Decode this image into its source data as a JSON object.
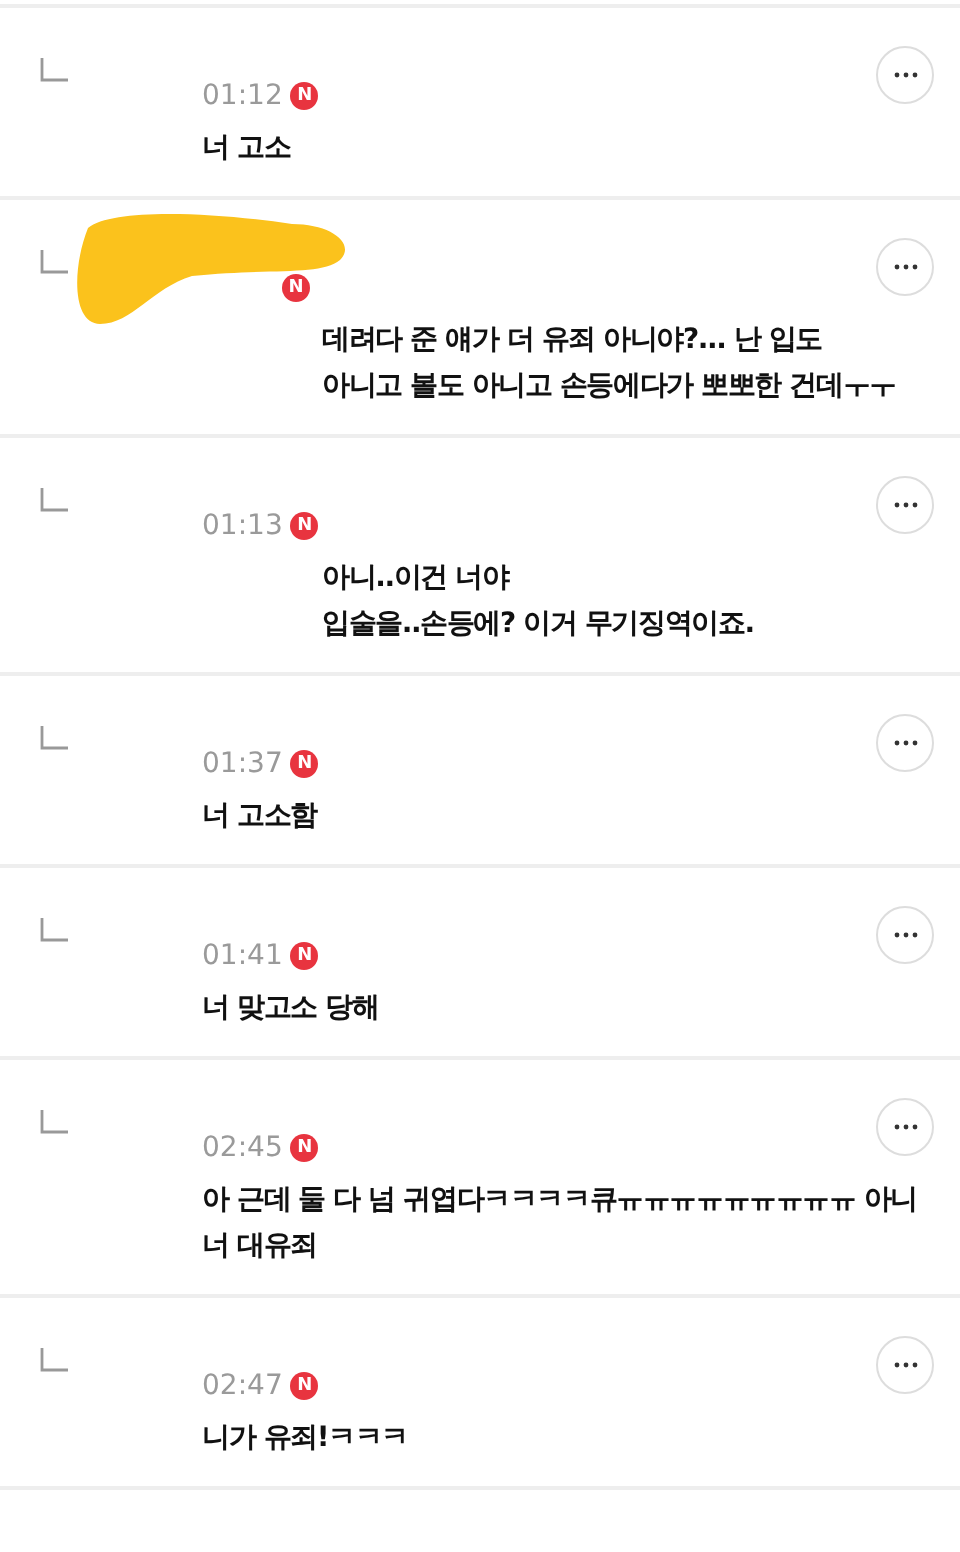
{
  "comments": [
    {
      "time": "01:12",
      "badge": "N",
      "redacted": false,
      "first_line_indented": false,
      "lines": [
        "너 고소"
      ]
    },
    {
      "badge": "N",
      "redacted": true,
      "first_line_indented": true,
      "lines": [
        "데려다 준 얘가 더 유죄 아니야?... 난 입도",
        "아니고 볼도 아니고 손등에다가 뽀뽀한 건데ㅜㅜ"
      ]
    },
    {
      "time": "01:13",
      "badge": "N",
      "redacted": false,
      "first_line_indented": true,
      "lines": [
        "아니..이건 너야",
        "입술을..손등에? 이거 무기징역이죠."
      ]
    },
    {
      "time": "01:37",
      "badge": "N",
      "redacted": false,
      "first_line_indented": false,
      "lines": [
        "너 고소함"
      ]
    },
    {
      "time": "01:41",
      "badge": "N",
      "redacted": false,
      "first_line_indented": false,
      "lines": [
        "너 맞고소 당해"
      ]
    },
    {
      "time": "02:45",
      "badge": "N",
      "redacted": false,
      "first_line_indented": false,
      "lines": [
        "아 근데 둘 다 넘 귀엽다ㅋㅋㅋㅋ큐ㅠㅠㅠㅠㅠㅠㅠㅠㅠ 아니",
        "너 대유죄"
      ]
    },
    {
      "time": "02:47",
      "badge": "N",
      "redacted": false,
      "first_line_indented": false,
      "lines": [
        "니가 유죄!ㅋㅋㅋ"
      ]
    }
  ]
}
